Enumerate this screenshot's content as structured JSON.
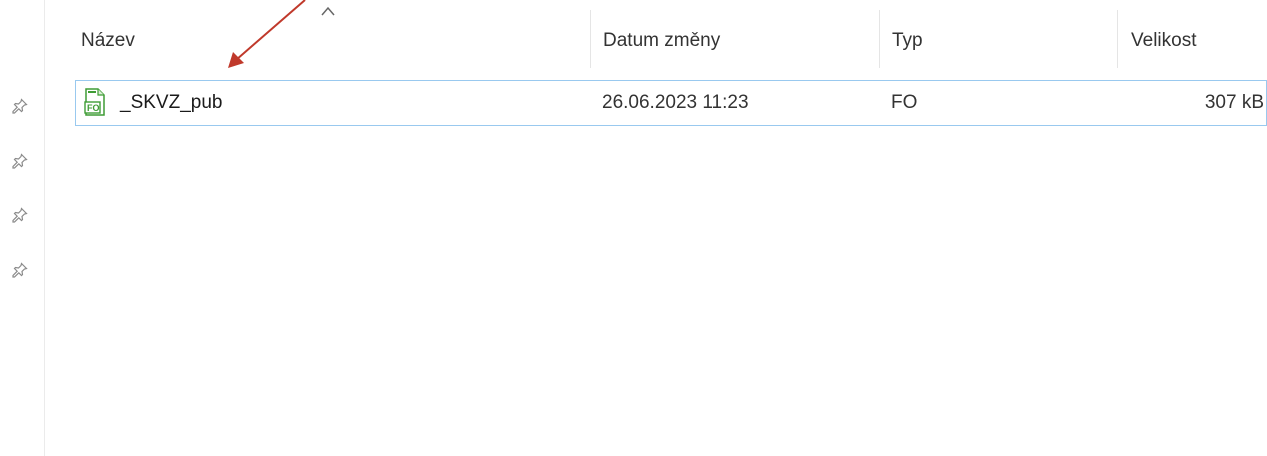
{
  "columns": {
    "name": "Název",
    "date": "Datum změny",
    "type": "Typ",
    "size": "Velikost"
  },
  "files": [
    {
      "name": "_SKVZ_pub",
      "date": "26.06.2023 11:23",
      "type": "FO",
      "size": "307 kB",
      "icon": "fo-file-icon",
      "icon_label": "FO"
    }
  ],
  "sort": {
    "column": "name",
    "direction": "ascending"
  },
  "quick_access_pins": 4,
  "colors": {
    "selection_border": "#99c9ef",
    "annotation_arrow": "#c0392b",
    "file_icon_green": "#3f9c35"
  }
}
